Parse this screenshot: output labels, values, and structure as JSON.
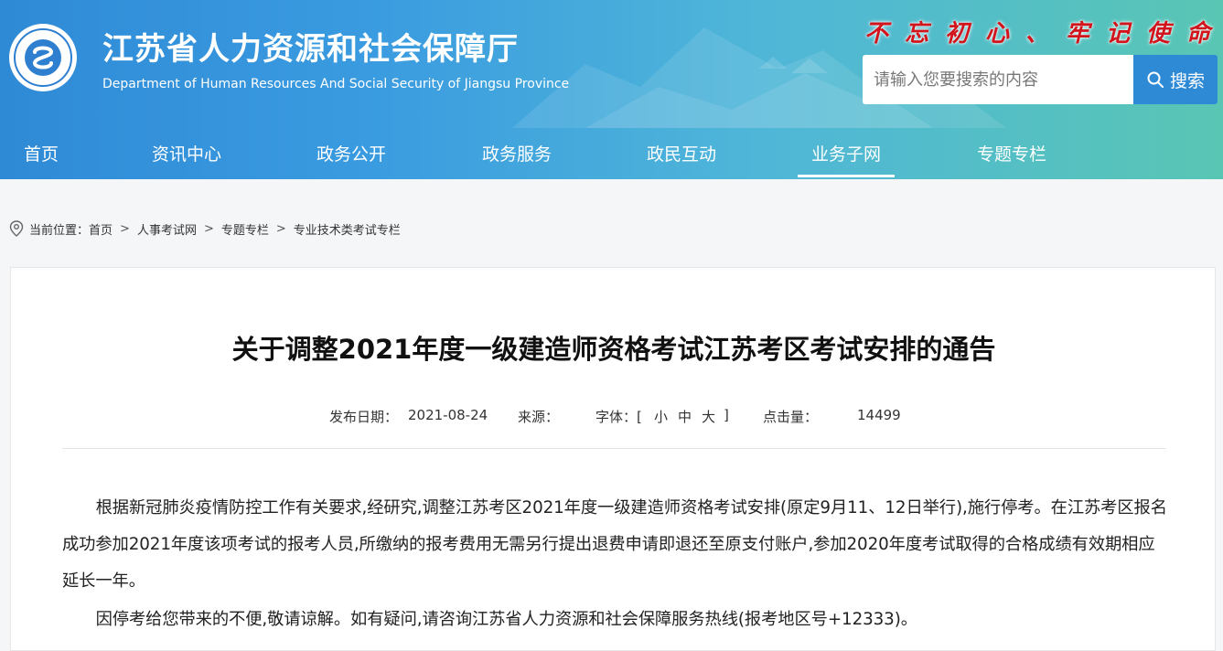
{
  "header": {
    "title": "江苏省人力资源和社会保障厅",
    "subtitle": "Department of Human Resources And Social Security of Jiangsu Province",
    "slogan": "不忘初心、牢记使命",
    "logo_icon": "ministry-logo-icon",
    "colors": {
      "gradient_start": "#2f8ad6",
      "gradient_end": "#59c6b4",
      "slogan": "#d2141c"
    }
  },
  "search": {
    "placeholder": "请输入您要搜索的内容",
    "button_label": "搜索",
    "icon": "search-icon"
  },
  "nav": {
    "items": [
      {
        "label": "首页"
      },
      {
        "label": "资讯中心"
      },
      {
        "label": "政务公开"
      },
      {
        "label": "政务服务"
      },
      {
        "label": "政民互动"
      },
      {
        "label": "业务子网"
      },
      {
        "label": "专题专栏"
      }
    ],
    "active": "业务子网"
  },
  "breadcrumb": {
    "prefix": "当前位置：",
    "items": [
      "首页",
      "人事考试网",
      "专题专栏",
      "专业技术类考试专栏"
    ],
    "separator": ">",
    "icon": "location-pin-icon"
  },
  "article": {
    "title": "关于调整2021年度一级建造师资格考试江苏考区考试安排的通告",
    "meta": {
      "date_label": "发布日期：",
      "date": "2021-08-24",
      "source_label": "来源：",
      "source": "",
      "font_label": "字体：[",
      "font_small": "小",
      "font_medium": "中",
      "font_large": "大",
      "font_close": "]",
      "hits_label": "点击量：",
      "hits": "14499"
    },
    "paragraphs": [
      "根据新冠肺炎疫情防控工作有关要求,经研究,调整江苏考区2021年度一级建造师资格考试安排(原定9月11、12日举行),施行停考。在江苏考区报名成功参加2021年度该项考试的报考人员,所缴纳的报考费用无需另行提出退费申请即退还至原支付账户,参加2020年度考试取得的合格成绩有效期相应延长一年。",
      "因停考给您带来的不便,敬请谅解。如有疑问,请咨询江苏省人力资源和社会保障服务热线(报考地区号+12333)。"
    ]
  }
}
